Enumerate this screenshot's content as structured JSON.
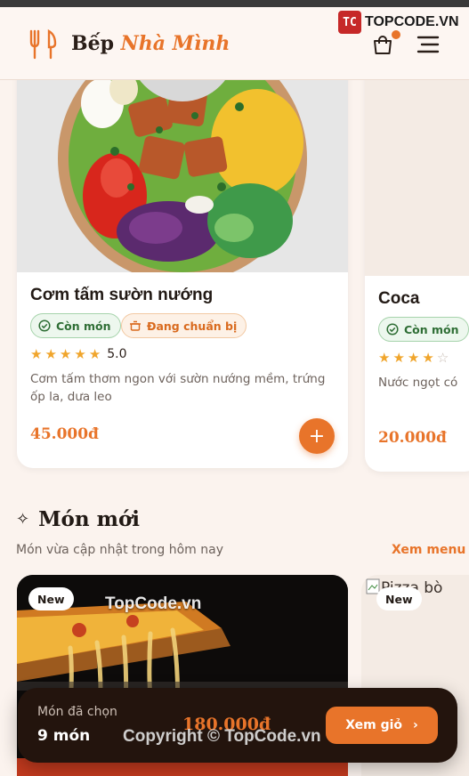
{
  "header": {
    "brand_main": "Bếp",
    "brand_accent": "Nhà Mình"
  },
  "watermark": {
    "logo_text": "TOPCODE.VN",
    "logo_mark": "TC",
    "center_text": "TopCode.vn",
    "copyright": "Copyright © TopCode.vn"
  },
  "featured": [
    {
      "title": "Cơm tấm sườn nướng",
      "status": "Còn món",
      "prep_status": "Đang chuẩn bị",
      "rating_value": 5,
      "rating": "5.0",
      "description": "Cơm tấm thơm ngon với sườn nướng mềm, trứng ốp la, dưa leo",
      "price": "45.000đ",
      "add_label": "+"
    },
    {
      "title": "Coca",
      "status": "Còn món",
      "rating_value": 4,
      "description": "Nước ngọt có",
      "price": "20.000đ"
    }
  ],
  "new_section": {
    "icon": "sparkle-icon",
    "title": "Món mới",
    "subtitle": "Món vừa cập nhật trong hôm nay",
    "see_menu": "Xem menu",
    "items": [
      {
        "badge": "New"
      },
      {
        "badge": "New",
        "image_alt": "Pizza bò"
      }
    ]
  },
  "cart_bar": {
    "label": "Món đã chọn",
    "count": "9 món",
    "total": "180.000đ",
    "button": "Xem giỏ",
    "button_icon": "chevron-right-icon"
  },
  "colors": {
    "accent": "#e8742a",
    "background": "#fbf3ee",
    "dark": "#23140d",
    "green": "#2f6e35"
  }
}
